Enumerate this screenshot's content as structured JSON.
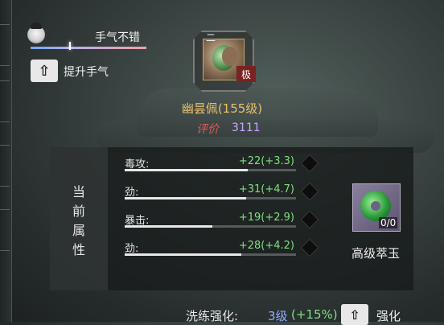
{
  "luck": {
    "label": "手气不错",
    "level": 0.33
  },
  "boost": {
    "icon": "arrow-up",
    "label": "提升手气"
  },
  "item": {
    "tier_mark": "二",
    "grade": "极",
    "name": "幽昙佩(155级)",
    "score_label": "评价",
    "score": "3111"
  },
  "panel": {
    "title_chars": [
      "当",
      "前",
      "属",
      "性"
    ],
    "stats": [
      {
        "name": "毒攻:",
        "value": "+22",
        "bonus": "(+3.3)",
        "fill": 0.72
      },
      {
        "name": "劲:",
        "value": "+31",
        "bonus": "(+4.7)",
        "fill": 0.71
      },
      {
        "name": "暴击:",
        "value": "+19",
        "bonus": "(+2.9)",
        "fill": 0.51
      },
      {
        "name": "劲:",
        "value": "+28",
        "bonus": "(+4.2)",
        "fill": 0.68
      }
    ],
    "material": {
      "name": "高级萃玉",
      "count": "0/0"
    }
  },
  "refine": {
    "label": "洗练强化:",
    "level": "3级",
    "bonus": "(+15%)",
    "button_label": "强化"
  },
  "colors": {
    "gold": "#e8c06a",
    "green": "#7fe07f",
    "blue": "#8fb0ff",
    "purple": "#c8a8ff"
  }
}
